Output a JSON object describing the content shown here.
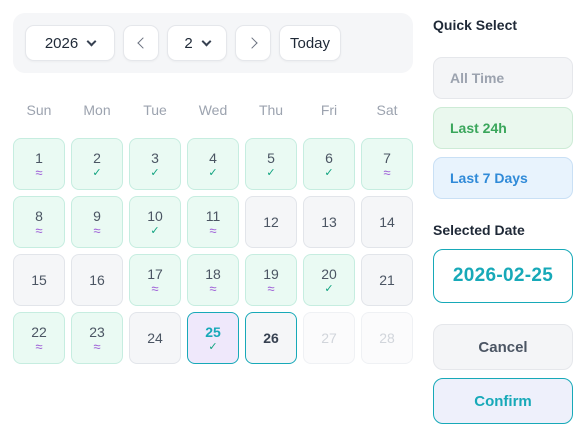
{
  "toolbar": {
    "year": "2026",
    "month": "2",
    "today_label": "Today"
  },
  "weekdays": [
    "Sun",
    "Mon",
    "Tue",
    "Wed",
    "Thu",
    "Fri",
    "Sat"
  ],
  "legend_marks": {
    "check": "✓",
    "wave": "≈"
  },
  "calendar": {
    "days": [
      {
        "day": "1",
        "status": "wave"
      },
      {
        "day": "2",
        "status": "check"
      },
      {
        "day": "3",
        "status": "check"
      },
      {
        "day": "4",
        "status": "check"
      },
      {
        "day": "5",
        "status": "check"
      },
      {
        "day": "6",
        "status": "check"
      },
      {
        "day": "7",
        "status": "wave"
      },
      {
        "day": "8",
        "status": "wave"
      },
      {
        "day": "9",
        "status": "wave"
      },
      {
        "day": "10",
        "status": "check"
      },
      {
        "day": "11",
        "status": "wave"
      },
      {
        "day": "12",
        "status": "none"
      },
      {
        "day": "13",
        "status": "none"
      },
      {
        "day": "14",
        "status": "none"
      },
      {
        "day": "15",
        "status": "none"
      },
      {
        "day": "16",
        "status": "none"
      },
      {
        "day": "17",
        "status": "wave"
      },
      {
        "day": "18",
        "status": "wave"
      },
      {
        "day": "19",
        "status": "wave"
      },
      {
        "day": "20",
        "status": "check"
      },
      {
        "day": "21",
        "status": "none"
      },
      {
        "day": "22",
        "status": "wave"
      },
      {
        "day": "23",
        "status": "wave"
      },
      {
        "day": "24",
        "status": "none"
      },
      {
        "day": "25",
        "status": "check",
        "selected": true
      },
      {
        "day": "26",
        "status": "none",
        "today": true
      },
      {
        "day": "27",
        "status": "none",
        "disabled": true
      },
      {
        "day": "28",
        "status": "none",
        "disabled": true
      }
    ]
  },
  "quick_select": {
    "title": "Quick Select",
    "all_time": "All Time",
    "last_24h": "Last 24h",
    "last_7_days": "Last 7 Days"
  },
  "selected_date": {
    "title": "Selected Date",
    "value": "2026-02-25"
  },
  "actions": {
    "cancel": "Cancel",
    "confirm": "Confirm"
  },
  "colors": {
    "accent": "#17a9b8",
    "recorded_bg": "#eafaf3",
    "check": "#10a37f",
    "wave": "#9b59d6",
    "selected_bg": "#efe8fb"
  }
}
